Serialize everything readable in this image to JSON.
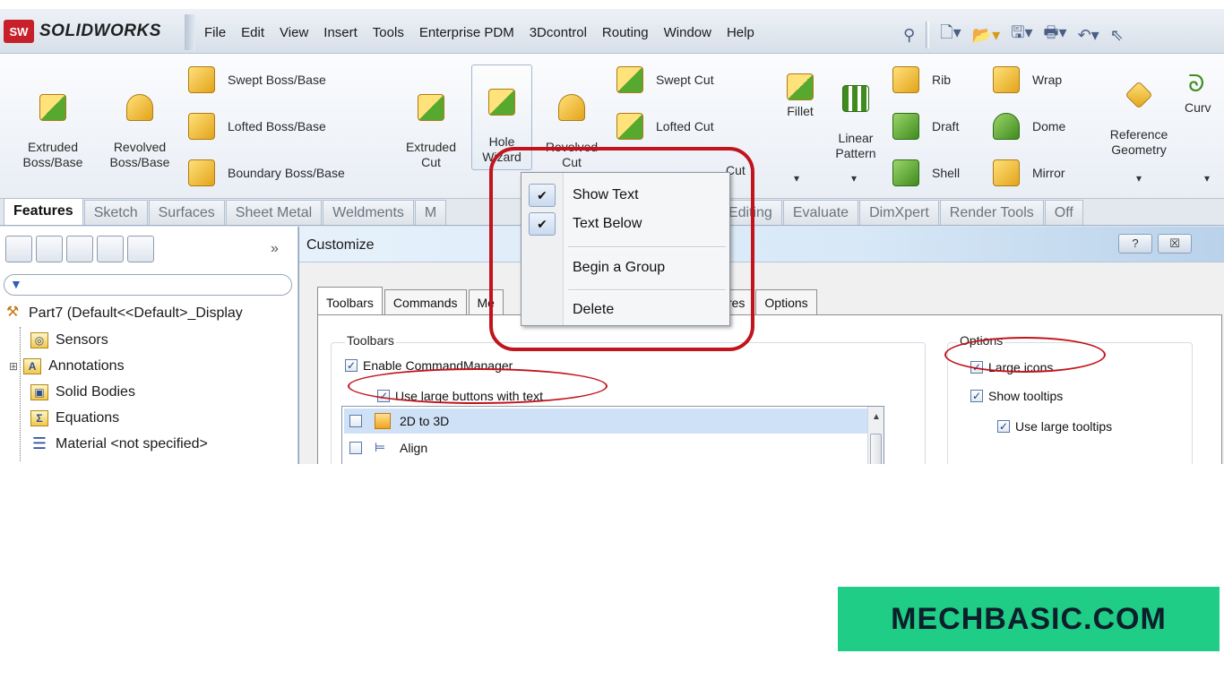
{
  "app": {
    "brand": "SOLIDWORKS",
    "brand_badge": "SW",
    "menu": [
      "File",
      "Edit",
      "View",
      "Insert",
      "Tools",
      "Enterprise PDM",
      "3Dcontrol",
      "Routing",
      "Window",
      "Help"
    ],
    "quick_access_icons": [
      "new-document-icon",
      "open-icon",
      "save-icon",
      "print-icon",
      "undo-icon",
      "select-icon"
    ]
  },
  "ribbon": {
    "extruded_boss": "Extruded\nBoss/Base",
    "revolved_boss": "Revolved\nBoss/Base",
    "swept_boss": "Swept Boss/Base",
    "lofted_boss": "Lofted Boss/Base",
    "boundary_boss": "Boundary Boss/Base",
    "extruded_cut": "Extruded\nCut",
    "hole_wizard": "Hole\nWizard",
    "revolved_cut": "Revolved\nCut",
    "swept_cut": "Swept Cut",
    "lofted_cut": "Lofted Cut",
    "boundary_cut_partial": "Cut",
    "fillet": "Fillet",
    "linear_pattern": "Linear\nPattern",
    "rib": "Rib",
    "draft": "Draft",
    "shell": "Shell",
    "wrap": "Wrap",
    "dome": "Dome",
    "mirror": "Mirror",
    "reference_geometry": "Reference\nGeometry",
    "curves_partial": "Curv",
    "dropdown_glyph": "▾"
  },
  "tabs": [
    "Features",
    "Sketch",
    "Surfaces",
    "Sheet Metal",
    "Weldments",
    "M",
    "irect Editing",
    "Evaluate",
    "DimXpert",
    "Render Tools",
    "Off"
  ],
  "tree": {
    "expand_glyph": "»",
    "part": "Part7  (Default<<Default>_Display",
    "items": [
      "Sensors",
      "Annotations",
      "Solid Bodies",
      "Equations",
      "Material <not specified>"
    ]
  },
  "dialog": {
    "title": "Customize",
    "help_btn": "?",
    "close_btn": "☒",
    "tabs": [
      "Toolbars",
      "Commands",
      "Me",
      "res",
      "Options"
    ],
    "toolbars_group": "Toolbars",
    "enable_cm": "Enable CommandManager",
    "large_buttons": "Use large buttons with text",
    "list_items": [
      "2D to 3D",
      "Align"
    ],
    "options_group": "Options",
    "large_icons": "Large icons",
    "show_tooltips": "Show tooltips",
    "large_tooltips": "Use large tooltips",
    "check_glyph": "✓"
  },
  "context_menu": {
    "show_text": "Show Text",
    "text_below": "Text Below",
    "begin_group": "Begin a Group",
    "delete": "Delete",
    "check_glyph": "✔"
  },
  "watermark": "MECHBASIC.COM",
  "colors": {
    "annotation_red": "#c1141c",
    "watermark_bg": "#1fcd87"
  }
}
